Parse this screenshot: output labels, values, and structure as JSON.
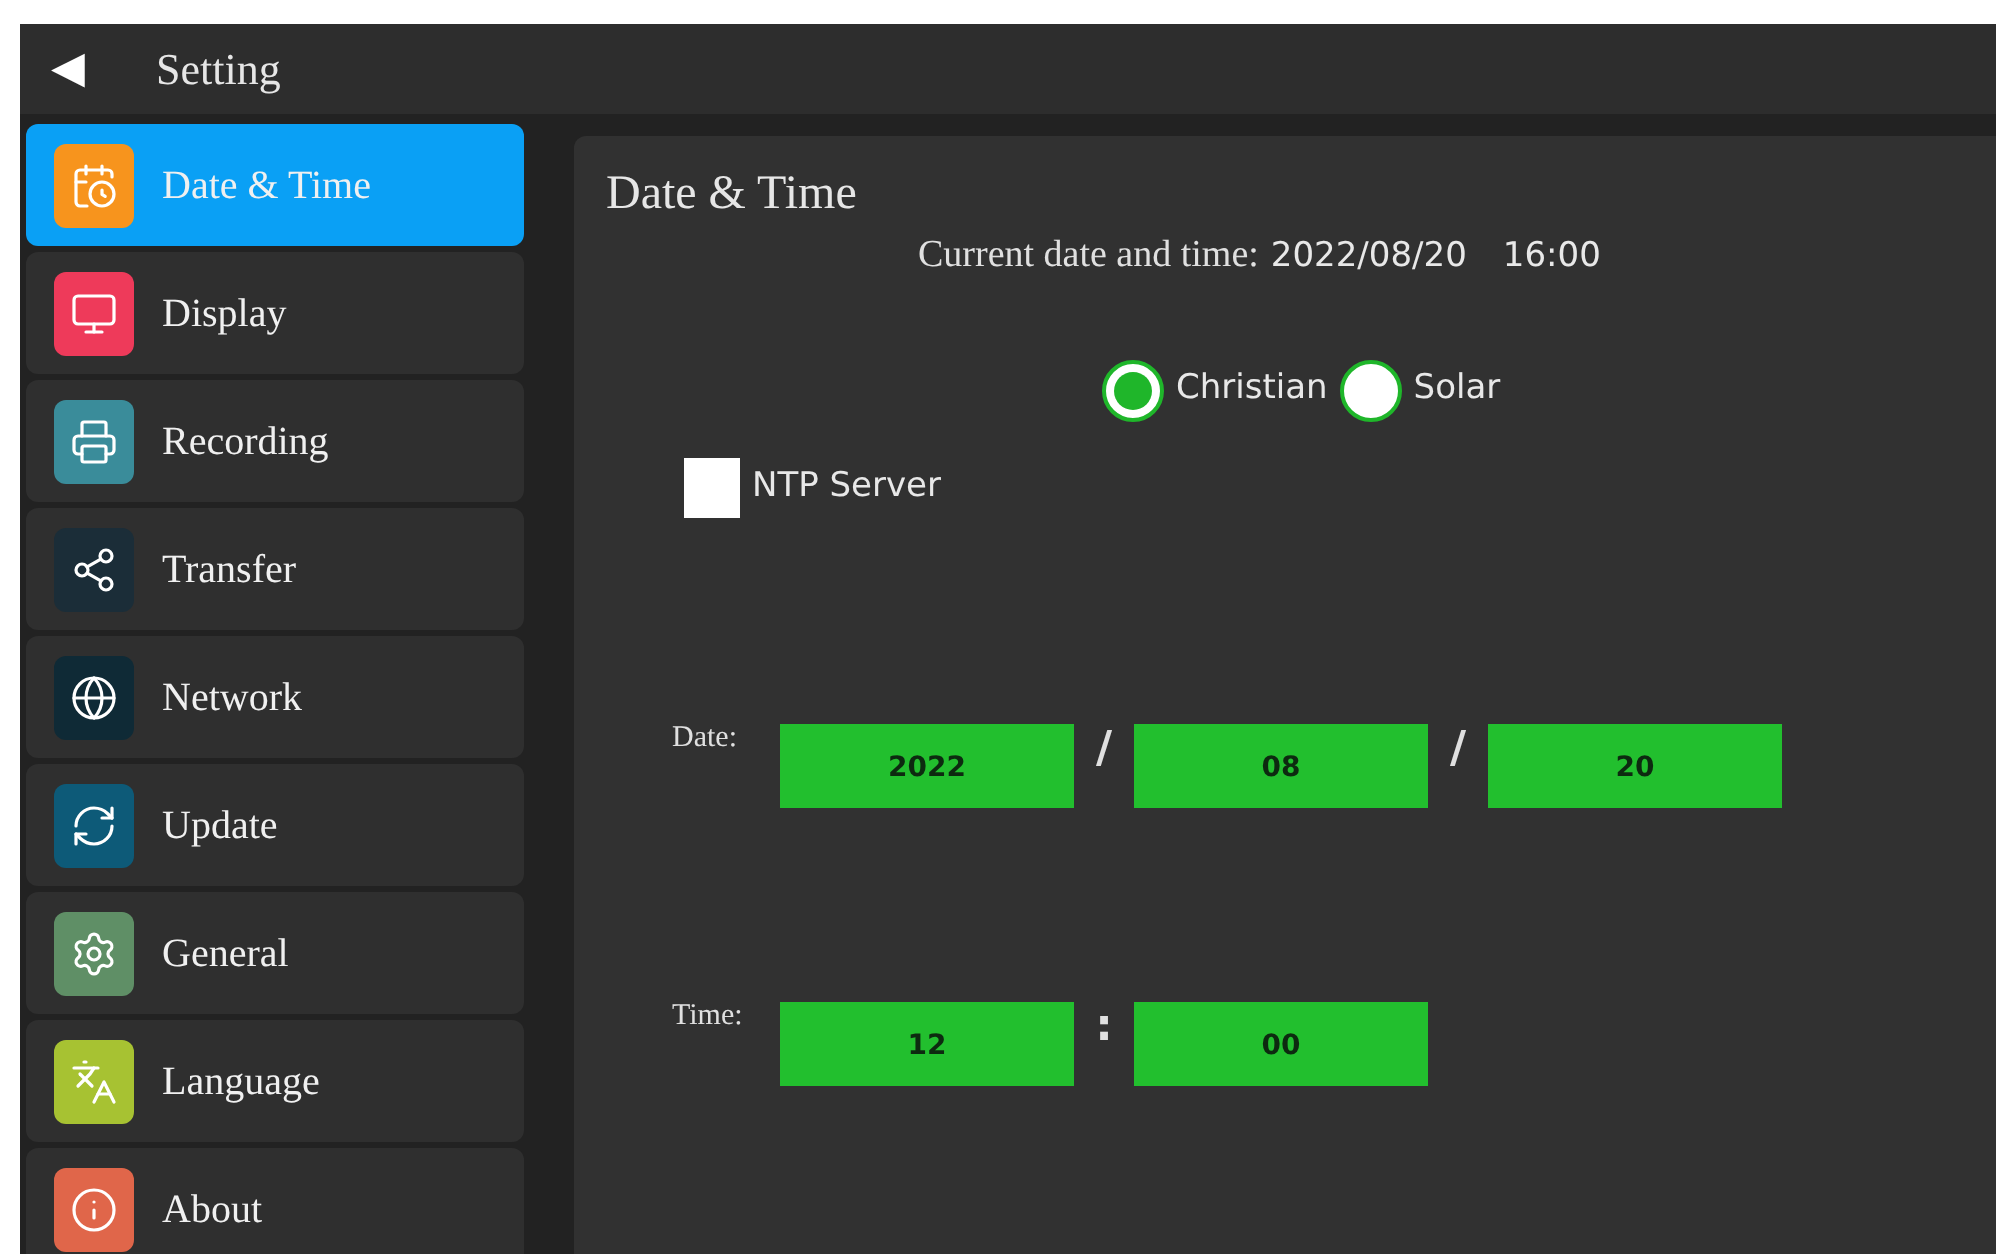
{
  "header": {
    "back": "◀",
    "title": "Setting"
  },
  "sidebar": {
    "items": [
      {
        "label": "Date & Time",
        "color": "#f7941d",
        "selected": true
      },
      {
        "label": "Display",
        "color": "#ee3a5a",
        "selected": false
      },
      {
        "label": "Recording",
        "color": "#3a8c9a",
        "selected": false
      },
      {
        "label": "Transfer",
        "color": "#1b2d38",
        "selected": false
      },
      {
        "label": "Network",
        "color": "#0f2a36",
        "selected": false
      },
      {
        "label": "Update",
        "color": "#0d5a78",
        "selected": false
      },
      {
        "label": "General",
        "color": "#5f8f66",
        "selected": false
      },
      {
        "label": "Language",
        "color": "#a7c232",
        "selected": false
      },
      {
        "label": "About",
        "color": "#e0664a",
        "selected": false
      }
    ]
  },
  "panel": {
    "title": "Date & Time",
    "current_label": "Current date and time:",
    "current_date": "2022/08/20",
    "current_time": "16:00",
    "calendars": [
      {
        "label": "Christian",
        "selected": true
      },
      {
        "label": "Solar",
        "selected": false
      }
    ],
    "ntp": {
      "label": "NTP Server",
      "checked": false
    },
    "date": {
      "label": "Date:",
      "separator": "/",
      "fields": [
        "2022",
        "08",
        "20"
      ]
    },
    "time": {
      "label": "Time:",
      "separator": ":",
      "fields": [
        "12",
        "00"
      ]
    }
  }
}
